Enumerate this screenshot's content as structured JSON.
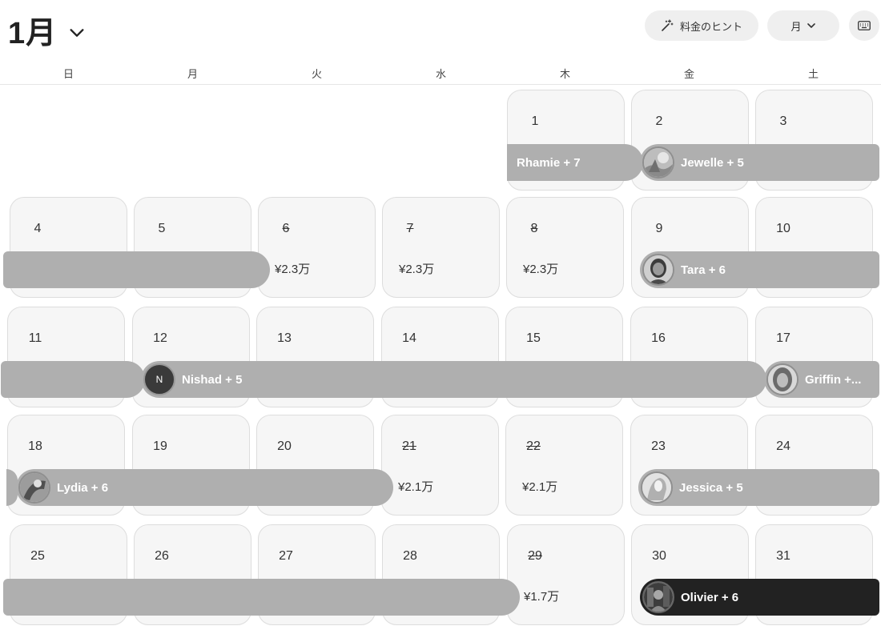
{
  "header": {
    "month_title": "1月",
    "price_hint_label": "料金のヒント",
    "view_label": "月"
  },
  "weekdays": [
    "日",
    "月",
    "火",
    "水",
    "木",
    "金",
    "土"
  ],
  "days": {
    "d1": "1",
    "d2": "2",
    "d3": "3",
    "d4": "4",
    "d5": "5",
    "d6": "6",
    "d7": "7",
    "d8": "8",
    "d9": "9",
    "d10": "10",
    "d11": "11",
    "d12": "12",
    "d13": "13",
    "d14": "14",
    "d15": "15",
    "d16": "16",
    "d17": "17",
    "d18": "18",
    "d19": "19",
    "d20": "20",
    "d21": "21",
    "d22": "22",
    "d23": "23",
    "d24": "24",
    "d25": "25",
    "d26": "26",
    "d27": "27",
    "d28": "28",
    "d29": "29",
    "d30": "30",
    "d31": "31"
  },
  "prices": {
    "p6": "¥2.3万",
    "p7": "¥2.3万",
    "p8": "¥2.3万",
    "p21": "¥2.1万",
    "p22": "¥2.1万",
    "p29": "¥1.7万"
  },
  "reservations": {
    "rhamie": "Rhamie + 7",
    "jewelle": "Jewelle + 5",
    "tara": "Tara + 6",
    "nishad": "Nishad + 5",
    "nishad_initial": "N",
    "griffin": "Griffin +...",
    "lydia": "Lydia + 6",
    "jessica": "Jessica + 5",
    "olivier": "Olivier + 6"
  },
  "colors": {
    "bar_default": "#afafaf",
    "bar_active": "#222222",
    "cell_bg": "#f6f6f6",
    "pill_bg": "#efefef"
  },
  "icons": {
    "month_toggle": "chevron-down-icon",
    "price_hint": "magic-wand-icon",
    "view_toggle": "chevron-down-icon",
    "keyboard": "keyboard-icon"
  }
}
